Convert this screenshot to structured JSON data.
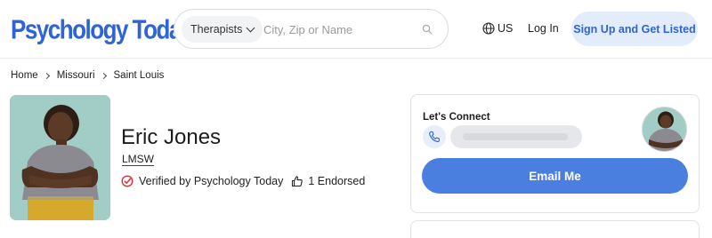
{
  "header": {
    "logo_text": "Psychology Today",
    "search": {
      "type_label": "Therapists",
      "placeholder": "City, Zip or Name",
      "value": ""
    },
    "region": "US",
    "login_label": "Log In",
    "signup_label": "Sign Up and Get Listed"
  },
  "breadcrumb": [
    "Home",
    "Missouri",
    "Saint Louis"
  ],
  "profile": {
    "name": "Eric Jones",
    "credential": "LMSW",
    "verified_text": "Verified by Psychology Today",
    "endorsed_text": "1 Endorsed"
  },
  "connect": {
    "title": "Let's Connect",
    "email_label": "Email Me"
  },
  "colors": {
    "brand_blue": "#2f64d6",
    "button_blue": "#4a7fe0",
    "signup_bg": "#e3ecfa",
    "verified_red": "#d6323b"
  },
  "icons": [
    "chevron-down-icon",
    "search-icon",
    "globe-icon",
    "chevron-right-icon",
    "verified-check-icon",
    "thumbs-up-icon",
    "phone-icon"
  ]
}
